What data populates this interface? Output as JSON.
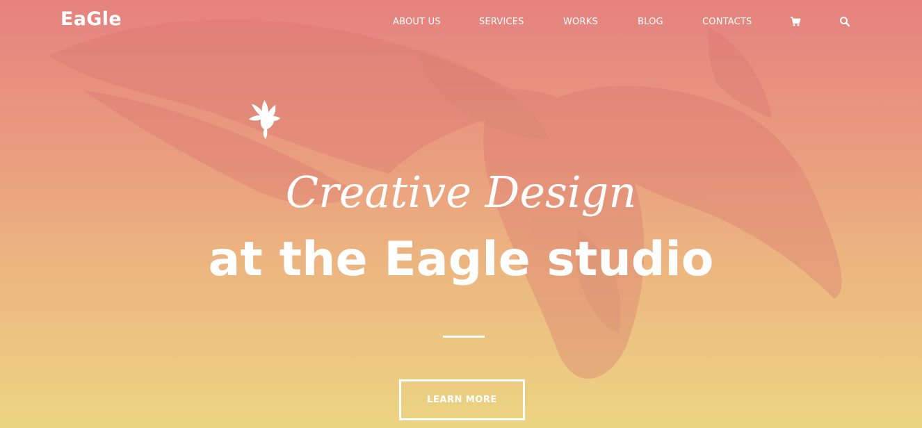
{
  "brand": {
    "logo_text": "EaGle"
  },
  "nav": {
    "items": [
      {
        "label": "ABOUT US"
      },
      {
        "label": "SERVICES"
      },
      {
        "label": "WORKS"
      },
      {
        "label": "BLOG"
      },
      {
        "label": "CONTACTS"
      }
    ],
    "icons": [
      "cart-icon",
      "search-icon"
    ]
  },
  "hero": {
    "script_title": "Creative Design",
    "main_title": "at the Eagle studio",
    "cta_label": "LEARN MORE"
  },
  "colors": {
    "gradient_top": "#e5827f",
    "gradient_mid": "#ecb480",
    "gradient_bottom": "#ecd582",
    "text": "#ffffff"
  }
}
